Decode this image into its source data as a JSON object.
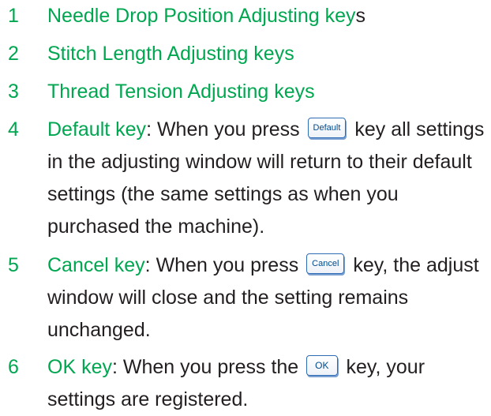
{
  "items": [
    {
      "num": "1",
      "label_a": "Needle Drop Position Adjusting key",
      "label_b": "s"
    },
    {
      "num": "2",
      "label": "Stitch Length Adjusting keys"
    },
    {
      "num": "3",
      "label": "Thread Tension Adjusting keys"
    },
    {
      "num": "4",
      "label": "Default key",
      "text_pre": ":  When you press ",
      "button": "Default",
      "text_post": " key all settings in the adjusting window will return to their default settings (the same settings as when you purchased the machine)."
    },
    {
      "num": "5",
      "label": "Cancel key",
      "text_pre": ":  When you press ",
      "button": "Cancel",
      "text_post": " key, the adjust window will close and the setting remains unchanged."
    },
    {
      "num": "6",
      "label": "OK key",
      "text_pre": ":  When you press the ",
      "button": "OK",
      "text_post": " key, your settings are registered."
    }
  ],
  "colors": {
    "accent": "#00a650",
    "text": "#231f20",
    "button_border": "#2e6cb5"
  }
}
